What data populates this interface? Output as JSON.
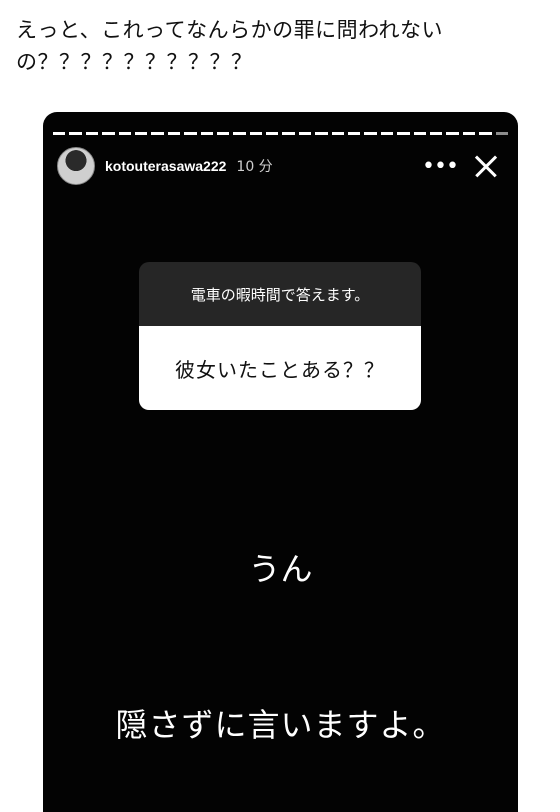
{
  "tweet": {
    "text": "えっと、これってなんらかの罪に問われない\nの？？？？？？？？？？"
  },
  "story": {
    "progress_segments": 28,
    "username": "kotouterasawa222",
    "timestamp": "10 分",
    "more_icon": "more-horizontal-icon",
    "close_icon": "close-icon",
    "question_header": "電車の暇時間で答えます。",
    "question_text": "彼女いたことある？？",
    "answer_line1": "うん",
    "answer_line2": "隠さずに言いますよ。"
  },
  "colors": {
    "story_bg": "#030303",
    "question_header_bg": "#262626",
    "question_body_bg": "#ffffff"
  }
}
